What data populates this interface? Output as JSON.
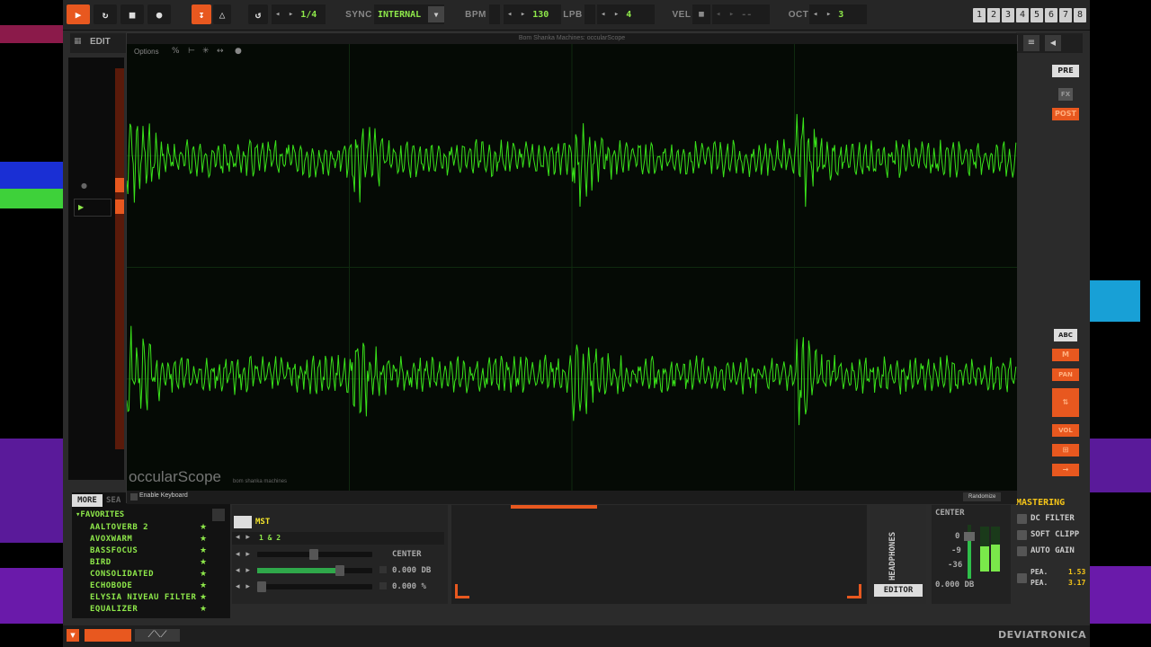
{
  "transport": {
    "page": "1/4",
    "sync_label": "SYNC",
    "sync_value": "INTERNAL",
    "bpm_label": "BPM",
    "bpm_value": "130",
    "lpb_label": "LPB",
    "lpb_value": "4",
    "vel_label": "VEL",
    "vel_value": "--",
    "oct_label": "OCT",
    "oct_value": "3",
    "pattern_tabs": [
      "1",
      "2",
      "3",
      "4",
      "5",
      "6",
      "7",
      "8"
    ]
  },
  "secondbar": {
    "edit_label": "EDIT"
  },
  "scope": {
    "window_title": "Bom Shanka Machines: occularScope",
    "options_label": "Options",
    "logo_text": "occularScope",
    "logo_sub": "bom shanka machines",
    "enable_keyboard_label": "Enable Keyboard",
    "randomize_label": "Randomize",
    "trace_color": "#39e21a"
  },
  "right_panel": {
    "pre_label": "PRE",
    "fx_label": "FX",
    "post_label": "POST",
    "abc_label": "ABC",
    "m_label": "M",
    "pan_label": "PAN",
    "vol_label": "VOL"
  },
  "browser": {
    "more_label": "MORE",
    "search_label": "SEA",
    "folder_label": "FAVORITES",
    "items": [
      "AALTOVERB 2",
      "AVOXWARM",
      "BASSFOCUS",
      "BIRD",
      "CONSOLIDATED",
      "ECHOBODE",
      "ELYSIA NIVEAU FILTER",
      "EQUALIZER"
    ],
    "star": "★"
  },
  "mixer": {
    "track_name": "MST",
    "channels": "1 & 2",
    "pan_label": "CENTER",
    "vol_value": "0.000 DB",
    "width_value": "0.000 %",
    "vol_level": 0.72
  },
  "headphones": {
    "label": "HEADPHONES",
    "editor_label": "EDITOR"
  },
  "output": {
    "pan_label": "CENTER",
    "scale": [
      "0",
      "-9",
      "-36"
    ],
    "db_value": "0.000 DB"
  },
  "mastering": {
    "title": "MASTERING",
    "items": [
      "DC FILTER",
      "SOFT CLIPP",
      "AUTO GAIN"
    ],
    "peak_label_1": "PEA.",
    "peak_value_1": "1.53",
    "peak_label_2": "PEA.",
    "peak_value_2": "3.17"
  },
  "brand": {
    "logo": "DEVIATRONICA"
  },
  "colors": {
    "accent_orange": "#e8581f",
    "accent_green": "#8ee84a",
    "mastering_yellow": "#f5c518"
  }
}
